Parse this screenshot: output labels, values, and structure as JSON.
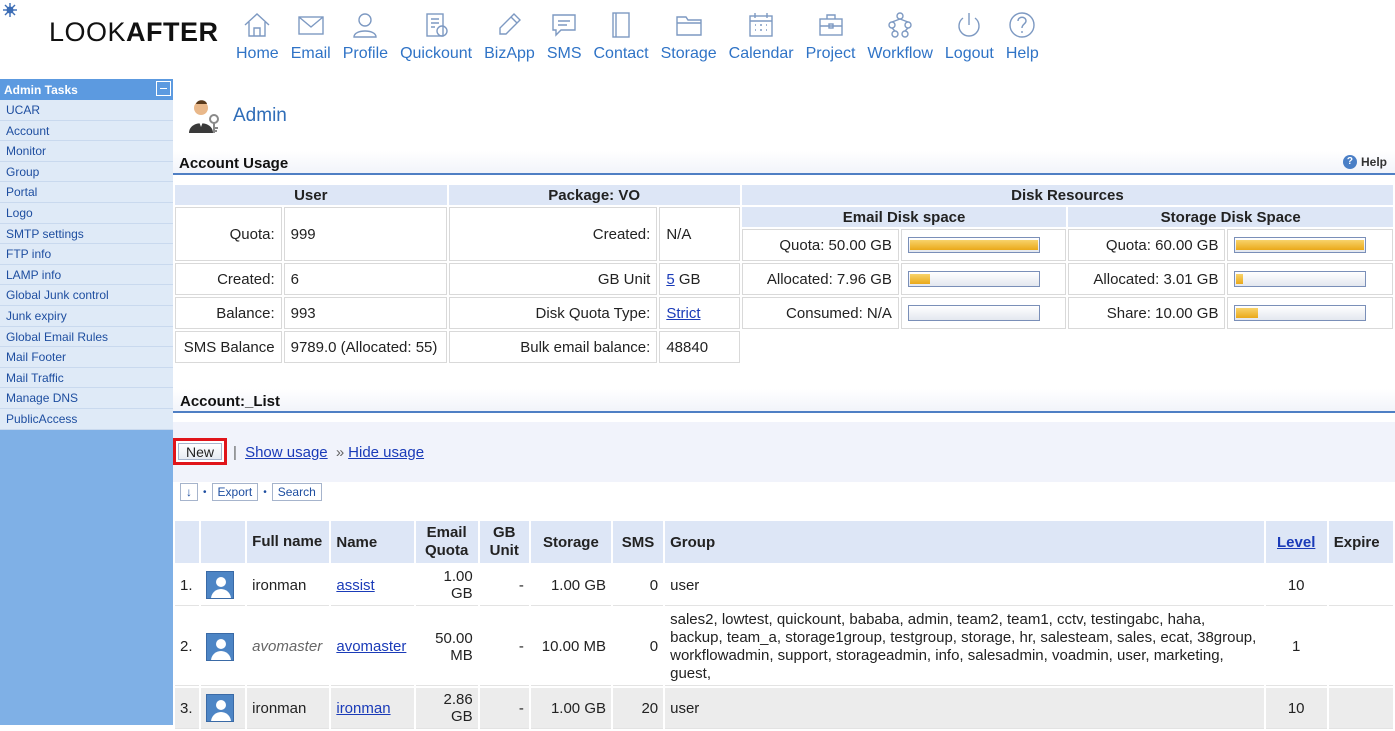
{
  "brand": {
    "logo_part1": "LOOK",
    "logo_part2": "AFTER"
  },
  "topnav": [
    {
      "label": "Home",
      "icon": "home-icon"
    },
    {
      "label": "Email",
      "icon": "email-icon"
    },
    {
      "label": "Profile",
      "icon": "profile-icon"
    },
    {
      "label": "Quickount",
      "icon": "quickount-icon"
    },
    {
      "label": "BizApp",
      "icon": "bizapp-icon"
    },
    {
      "label": "SMS",
      "icon": "sms-icon"
    },
    {
      "label": "Contact",
      "icon": "contact-icon"
    },
    {
      "label": "Storage",
      "icon": "storage-icon"
    },
    {
      "label": "Calendar",
      "icon": "calendar-icon"
    },
    {
      "label": "Project",
      "icon": "project-icon"
    },
    {
      "label": "Workflow",
      "icon": "workflow-icon"
    },
    {
      "label": "Logout",
      "icon": "logout-icon"
    },
    {
      "label": "Help",
      "icon": "help-icon"
    }
  ],
  "sidebar": {
    "title": "Admin Tasks",
    "items": [
      "UCAR",
      "Account",
      "Monitor",
      "Group",
      "Portal",
      "Logo",
      "SMTP settings",
      "FTP info",
      "LAMP info",
      "Global Junk control",
      "Junk expiry",
      "Global Email Rules",
      "Mail Footer",
      "Mail Traffic",
      "Manage DNS",
      "PublicAccess"
    ]
  },
  "page": {
    "title": "Admin"
  },
  "usage": {
    "section_title": "Account Usage",
    "help_label": "Help",
    "user_header": "User",
    "package_header": "Package: VO",
    "disk_header": "Disk Resources",
    "email_disk_header": "Email Disk space",
    "storage_disk_header": "Storage Disk Space",
    "user": {
      "quota_label": "Quota:",
      "quota": "999",
      "created_label": "Created:",
      "created": "6",
      "balance_label": "Balance:",
      "balance": "993",
      "sms_label": "SMS Balance",
      "sms": "9789.0 (Allocated: 55)"
    },
    "package": {
      "created_label": "Created:",
      "created": "N/A",
      "gb_label": "GB Unit",
      "gb_value": "5",
      "gb_suffix": "GB",
      "disk_type_label": "Disk Quota Type:",
      "disk_type": "Strict",
      "bulk_label": "Bulk email balance:",
      "bulk": "48840"
    },
    "email_disk": [
      {
        "label": "Quota: 50.00 GB",
        "fill": 1.0
      },
      {
        "label": "Allocated: 7.96 GB",
        "fill": 0.16
      },
      {
        "label": "Consumed: N/A",
        "fill": 0.0
      }
    ],
    "storage_disk": [
      {
        "label": "Quota: 60.00 GB",
        "fill": 1.0
      },
      {
        "label": "Allocated: 3.01 GB",
        "fill": 0.05
      },
      {
        "label": "Share: 10.00 GB",
        "fill": 0.17
      }
    ]
  },
  "account_list": {
    "section_title": "Account:_List",
    "new_label": "New",
    "separator": "|",
    "show_usage": "Show usage",
    "arrow": "»",
    "hide_usage": "Hide usage",
    "sort_arrow": "↓",
    "bullet": "•",
    "export_label": "Export",
    "search_label": "Search",
    "columns": [
      "Full name",
      "Name",
      "Email Quota",
      "GB Unit",
      "Storage",
      "SMS",
      "Group",
      "Level",
      "Expire"
    ],
    "rows": [
      {
        "idx": "1.",
        "full_name": "ironman",
        "name": "assist",
        "email_quota": "1.00 GB",
        "gb_unit": "-",
        "storage": "1.00 GB",
        "sms": "0",
        "group": "user",
        "level": "10",
        "expire": ""
      },
      {
        "idx": "2.",
        "full_name": "avomaster",
        "name": "avomaster",
        "email_quota": "50.00 MB",
        "gb_unit": "-",
        "storage": "10.00 MB",
        "sms": "0",
        "group": "sales2, lowtest, quickount, bababa, admin, team2, team1, cctv, testingabc, haha, backup, team_a, storage1group, testgroup, storage, hr, salesteam, sales, ecat, 38group, workflowadmin, support, storageadmin, info, salesadmin, voadmin, user, marketing, guest,",
        "level": "1",
        "expire": ""
      },
      {
        "idx": "3.",
        "full_name": "ironman",
        "name": "ironman",
        "email_quota": "2.86 GB",
        "gb_unit": "-",
        "storage": "1.00 GB",
        "sms": "20",
        "group": "user",
        "level": "10",
        "expire": ""
      }
    ]
  }
}
